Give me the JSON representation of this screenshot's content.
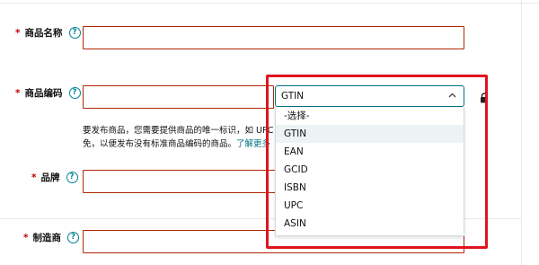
{
  "form": {
    "required_mark": "*",
    "help_glyph": "?",
    "fields": {
      "product_name": {
        "label": "商品名称",
        "value": ""
      },
      "product_code": {
        "label": "商品编码",
        "value": ""
      },
      "brand": {
        "label": "品牌",
        "value": ""
      },
      "manufacturer": {
        "label": "制造商",
        "value": ""
      }
    },
    "code_type": {
      "selected": "GTIN",
      "options": [
        "-选择-",
        "GTIN",
        "EAN",
        "GCID",
        "ISBN",
        "UPC",
        "ASIN"
      ]
    },
    "help_text": {
      "line1": "要发布商品，您需要提供商品的唯一标识，如 UPC",
      "line2": "免，以便发布没有标准商品编码的商品。",
      "link": "了解更多"
    }
  },
  "icons": [
    "help-icon",
    "chevron-up-icon",
    "lock-icon"
  ],
  "colors": {
    "error_border": "#b12704",
    "focus_border": "#007185",
    "help_icon": "#008296",
    "highlight": "#e0141e",
    "selected_option_bg": "#edf3f4"
  }
}
